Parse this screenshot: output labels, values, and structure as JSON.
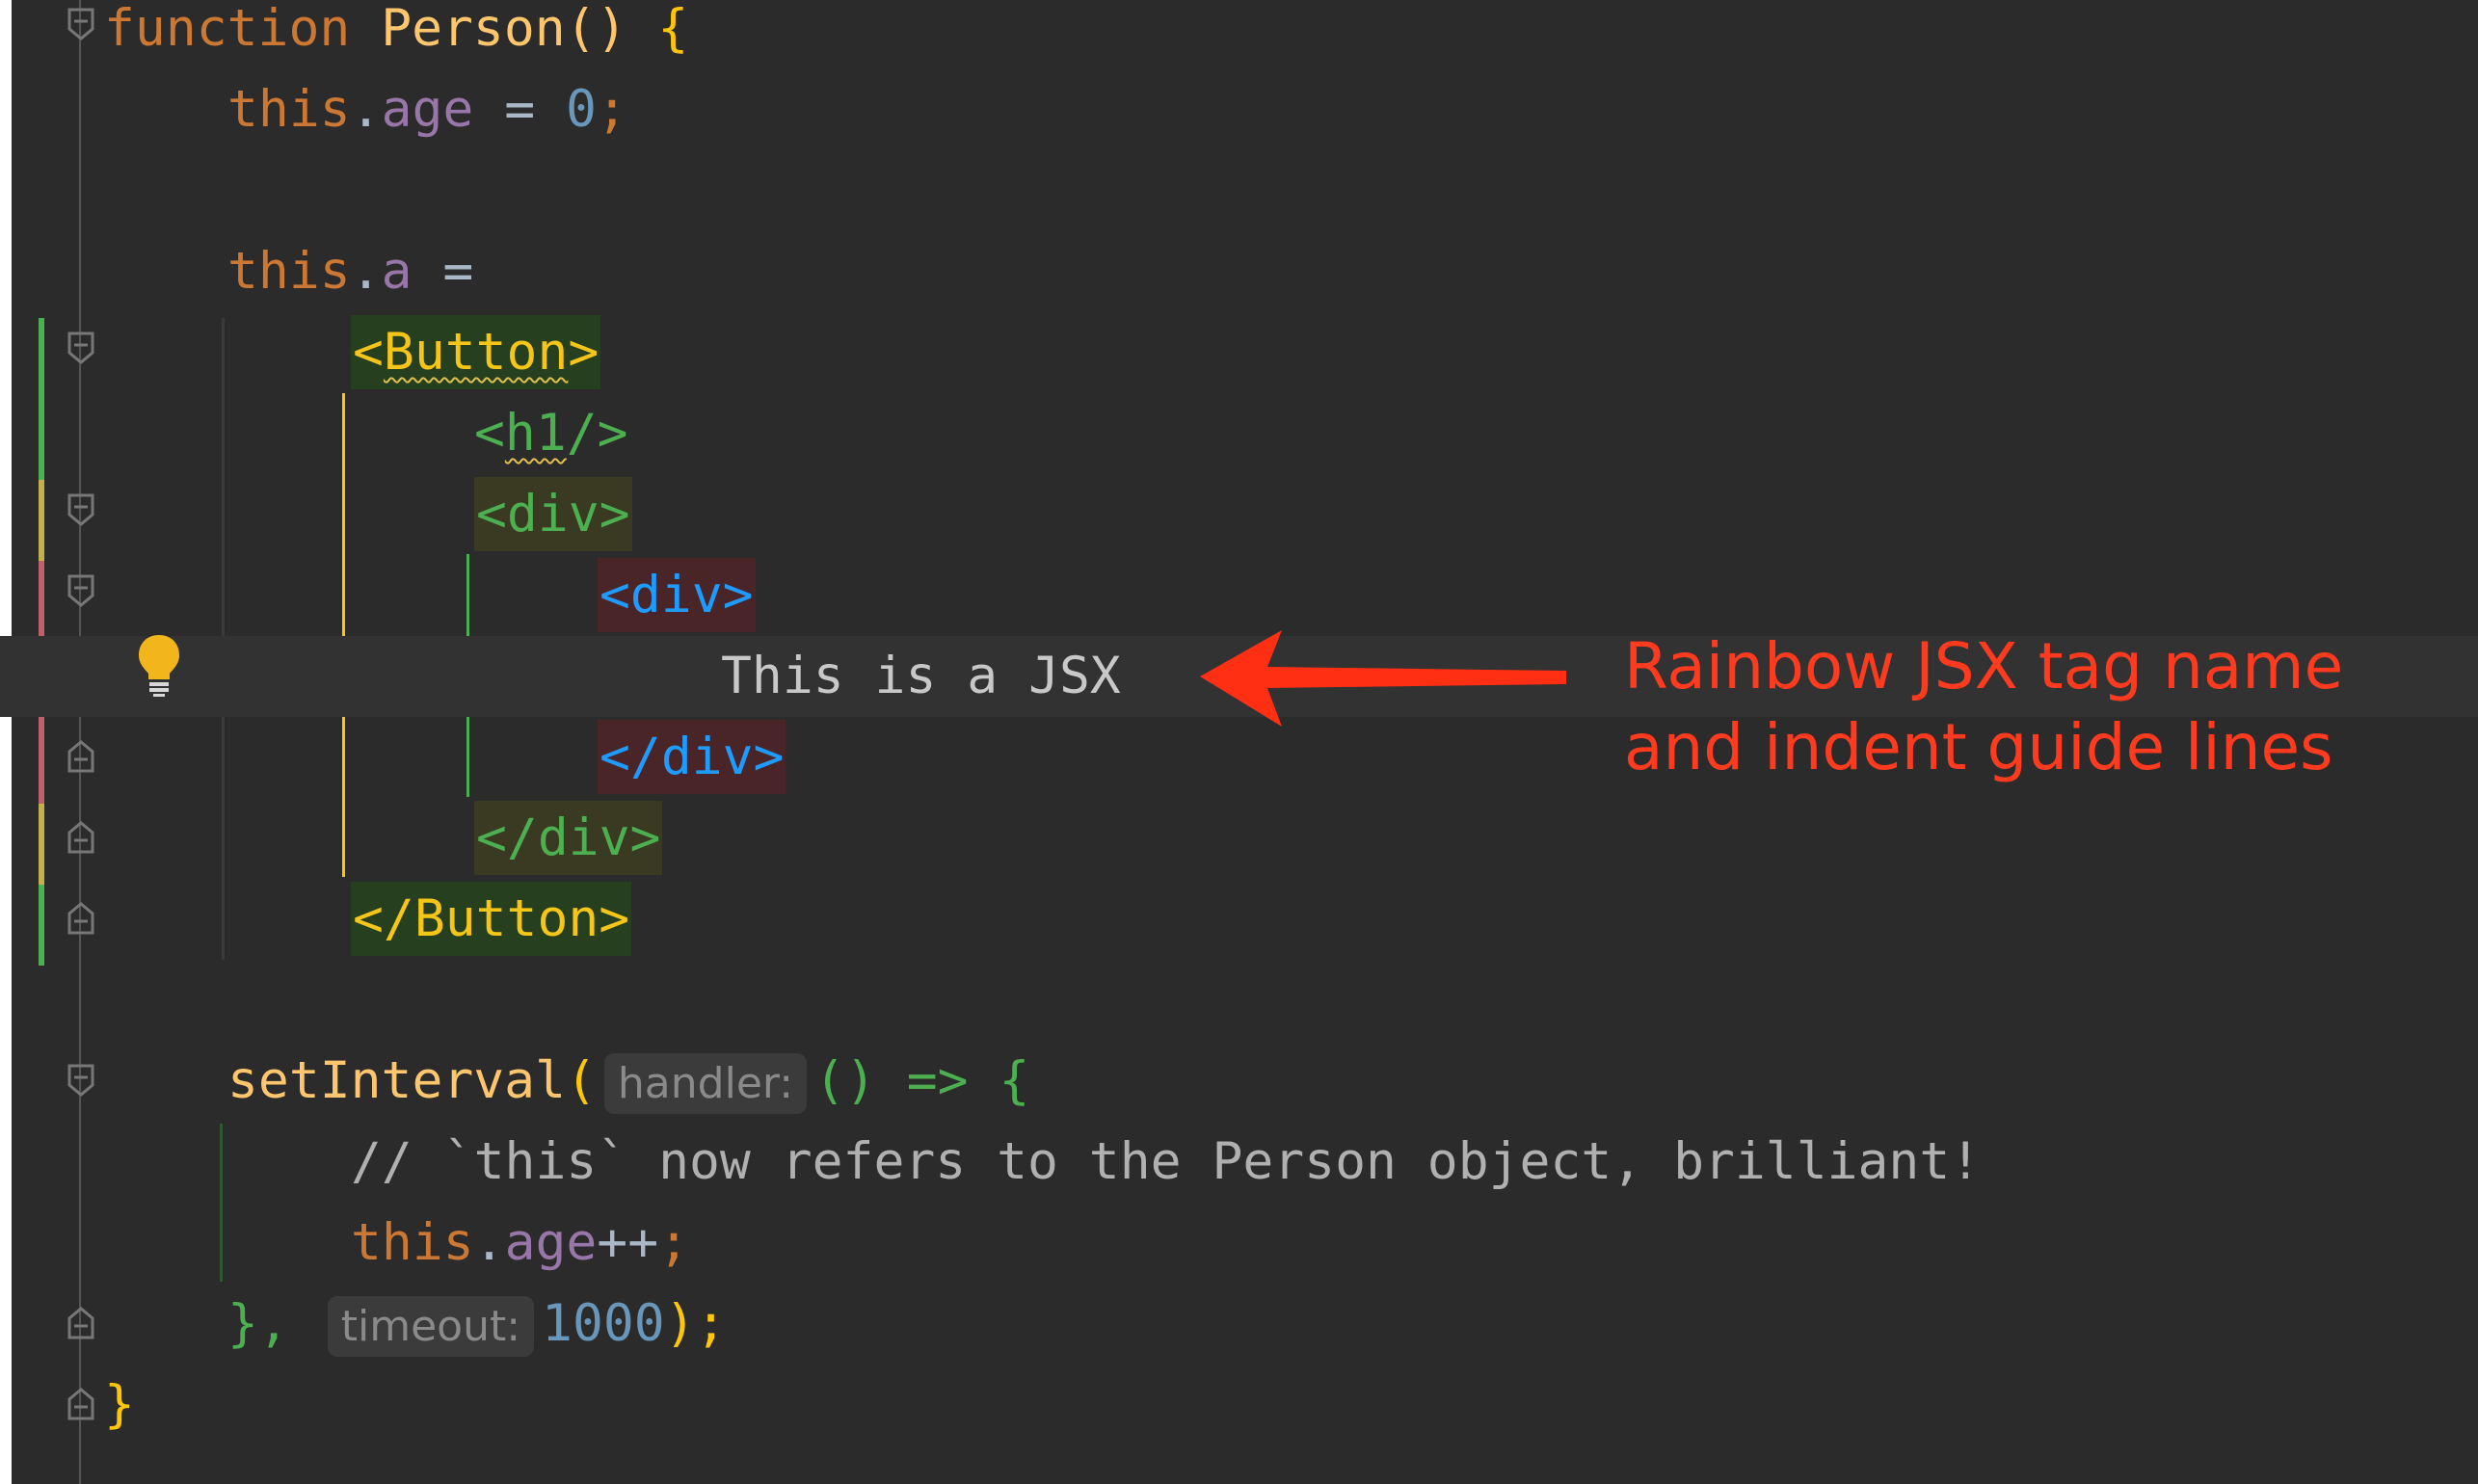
{
  "editor": {
    "lines": {
      "l1": {
        "kw": "function",
        "name": "Person",
        "rest": "() ",
        "brace": "{"
      },
      "l2": {
        "this": "this",
        "dot": ".",
        "prop": "age",
        "op": " = ",
        "num": "0",
        "semi": ";"
      },
      "l3": {
        "this": "this",
        "dot": ".",
        "prop": "a",
        "op": " ="
      },
      "l4": {
        "tag": "<Button>",
        "tag_open": "<",
        "tag_name": "Button",
        "tag_close": ">"
      },
      "l5": {
        "tag_open": "<",
        "tag_name": "h1",
        "tag_close": "/>"
      },
      "l6": {
        "tag": "<div>"
      },
      "l7": {
        "tag": "<div>"
      },
      "l8": {
        "text": "This is a JSX"
      },
      "l9": {
        "tag": "</div>"
      },
      "l10": {
        "tag": "</div>"
      },
      "l11": {
        "tag": "</Button>"
      },
      "l12": {
        "call": "setInterval",
        "paren": "(",
        "hint": "handler:",
        "arrow_fn": "() => ",
        "brace": "{"
      },
      "l13": {
        "comment": "// `this` now refers to the Person object, brilliant!"
      },
      "l14": {
        "this": "this",
        "dot": ".",
        "prop": "age",
        "op": "++",
        "semi": ";"
      },
      "l15": {
        "close": "},",
        "hint": "timeout:",
        "num": "1000",
        "end": ");"
      },
      "l16": {
        "brace": "}"
      }
    }
  },
  "annotation": {
    "line1": "Rainbow JSX tag name",
    "line2": "and indent guide lines",
    "color": "#ff3b1f"
  },
  "icons": {
    "intention": "lightbulb-icon",
    "fold": "fold-marker-icon",
    "pointer": "arrow-icon"
  },
  "colors": {
    "background": "#2b2b2b",
    "keyword": "#cc7832",
    "function": "#ffc66d",
    "property": "#9876aa",
    "number": "#6897bb",
    "tag_level1": "#f5c518",
    "tag_level2": "#4caf50",
    "tag_level3": "#1e9bff"
  }
}
